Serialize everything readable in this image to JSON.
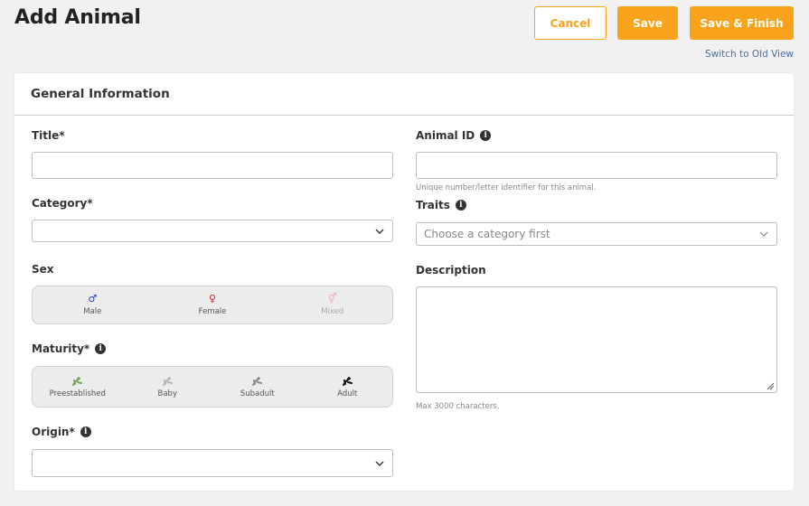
{
  "header": {
    "title": "Add Animal",
    "cancel_label": "Cancel",
    "save_label": "Save",
    "finish_label": "Save & Finish",
    "switch_link": "Switch to Old View"
  },
  "section": {
    "title": "General Information"
  },
  "form": {
    "title_label": "Title*",
    "title_value": "",
    "category_label": "Category*",
    "category_value": "",
    "sex_label": "Sex",
    "sex_options": [
      {
        "label": "Male",
        "icon": "♂",
        "icon_name": "male-icon",
        "color": "#1f3fbf",
        "enabled": true
      },
      {
        "label": "Female",
        "icon": "♀",
        "icon_name": "female-icon",
        "color": "#d21f1f",
        "enabled": true
      },
      {
        "label": "Mixed",
        "icon": "⚥",
        "icon_name": "mixed-icon",
        "color": "#f0a8b5",
        "enabled": false
      }
    ],
    "maturity_label": "Maturity*",
    "maturity_options": [
      {
        "label": "Preestablished",
        "icon_name": "preestablished-icon",
        "color": "#7aa35a"
      },
      {
        "label": "Baby",
        "icon_name": "baby-icon",
        "color": "#b5b5b5"
      },
      {
        "label": "Subadult",
        "icon_name": "subadult-icon",
        "color": "#8a8a8a"
      },
      {
        "label": "Adult",
        "icon_name": "adult-icon",
        "color": "#111111"
      }
    ],
    "origin_label": "Origin*",
    "origin_value": "",
    "animal_id_label": "Animal ID",
    "animal_id_value": "",
    "animal_id_hint": "Unique number/letter identifier for this animal.",
    "traits_label": "Traits",
    "traits_placeholder": "Choose a category first",
    "description_label": "Description",
    "description_value": "",
    "description_hint": "Max 3000 characters."
  },
  "colors": {
    "accent": "#f9a21b",
    "link": "#4a6fa5"
  }
}
